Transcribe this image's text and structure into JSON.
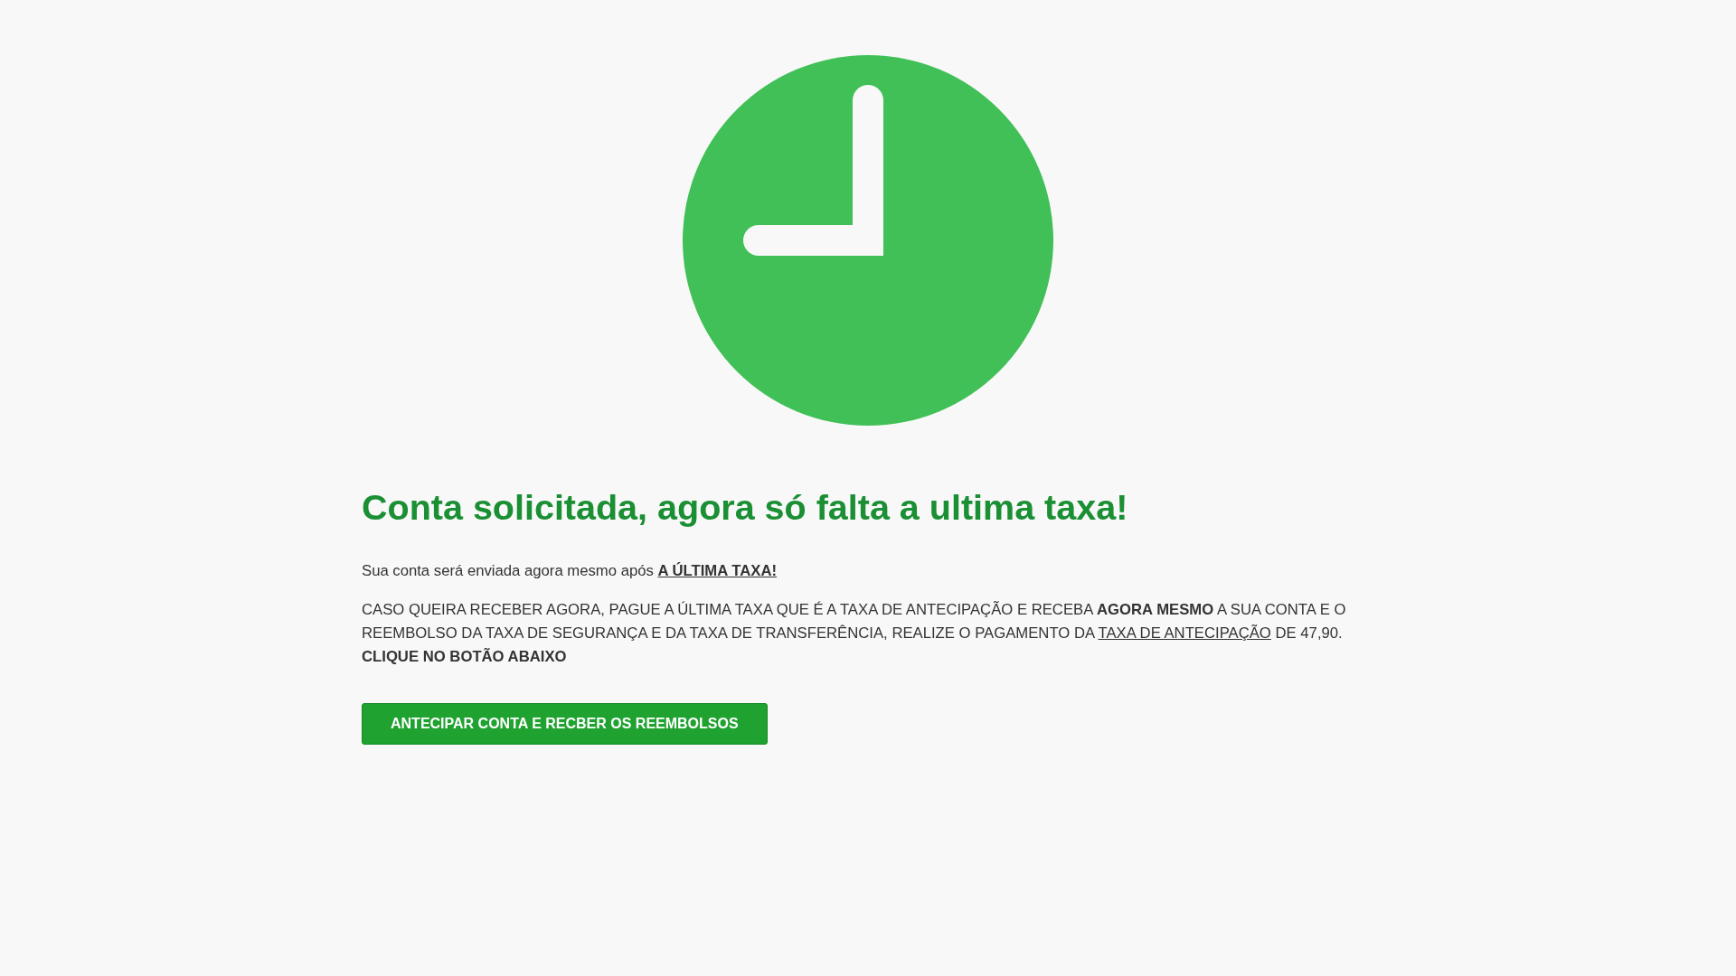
{
  "heading": "Conta solicitada, agora só falta a ultima taxa!",
  "paragraphs": [
    {
      "parts": [
        {
          "kind": "plain",
          "text": "Sua conta será enviada agora mesmo após "
        },
        {
          "kind": "link",
          "bold": true,
          "text": "A ÚLTIMA TAXA!"
        }
      ]
    },
    {
      "parts": [
        {
          "kind": "plain",
          "text": "CASO QUEIRA RECEBER AGORA, PAGUE A ÚLTIMA TAXA QUE É A TAXA DE ANTECIPAÇÃO E RECEBA **AGORA MESMO** A SUA CONTA E O REEMBOLSO DA TAXA DE SEGURANÇA E DA TAXA DE TRANSFERÊNCIA, REALIZE O PAGAMENTO DA "
        },
        {
          "kind": "link",
          "bold": false,
          "text": "TAXA DE ANTECIPAÇÃO"
        },
        {
          "kind": "plain",
          "text": " DE 47,90."
        }
      ],
      "note": "CLIQUE NO BOTÃO ABAIXO"
    }
  ],
  "button": "ANTECIPAR CONTA E RECBER OS REEMBOLSOS"
}
